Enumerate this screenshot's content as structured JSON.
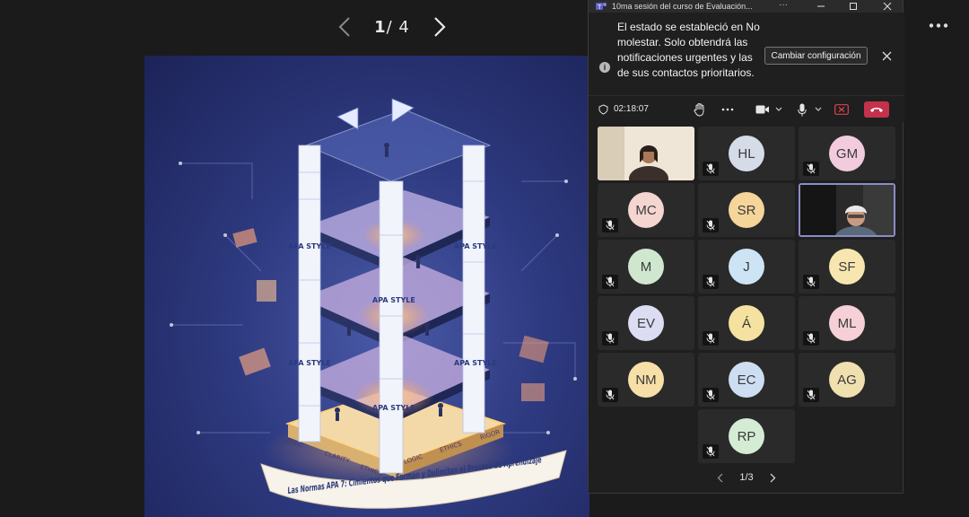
{
  "presentation": {
    "pager": {
      "current": "1",
      "total": "/ 4"
    },
    "slide": {
      "title_banner": "Las Normas APA 7: Cimientos que Forman y Delimitan el Proceso de Aprendizaje",
      "tower_label": "APA STYLE",
      "base_words": [
        "LOGIC",
        "CLARITY",
        "ETHICS",
        "LOGIC",
        "ETHICS",
        "RIGOR"
      ]
    }
  },
  "teams": {
    "window_title": "10ma sesión del curso de Evaluación...",
    "title_more": "···",
    "notification": {
      "message": "El estado se estableció en No molestar. Solo obtendrá las notificaciones urgentes y las de sus contactos prioritarios.",
      "button_label": "Cambiar configuración"
    },
    "toolbar": {
      "timer": "02:18:07"
    },
    "participants": [
      {
        "type": "video"
      },
      {
        "initials": "HL",
        "color": "#d6dbe8"
      },
      {
        "initials": "GM",
        "color": "#f2ccdc"
      },
      {
        "initials": "MC",
        "color": "#f5d5d0"
      },
      {
        "initials": "SR",
        "color": "#f5d59a"
      },
      {
        "type": "video",
        "selected": true
      },
      {
        "initials": "M",
        "color": "#cfe7cf"
      },
      {
        "initials": "J",
        "color": "#cde4f5"
      },
      {
        "initials": "SF",
        "color": "#f7e6b0"
      },
      {
        "initials": "EV",
        "color": "#dcdcf2"
      },
      {
        "initials": "Á",
        "color": "#f5e2a0"
      },
      {
        "initials": "ML",
        "color": "#f5d0d6"
      },
      {
        "initials": "NM",
        "color": "#f7dfa8"
      },
      {
        "initials": "EC",
        "color": "#cdddf2"
      },
      {
        "initials": "AG",
        "color": "#f0e0b0"
      },
      {
        "initials": "RP",
        "color": "#d4ecd4"
      }
    ],
    "grid_pager": "1/3"
  }
}
